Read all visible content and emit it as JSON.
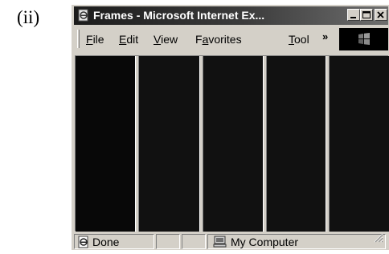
{
  "figure": {
    "caption": "(ii)"
  },
  "window": {
    "title": "Frames - Microsoft Internet Ex...",
    "controls": {
      "minimize": "minimize",
      "maximize": "maximize",
      "close": "close"
    }
  },
  "menubar": {
    "items": [
      {
        "label": "File",
        "accel": "F"
      },
      {
        "label": "Edit",
        "accel": "E"
      },
      {
        "label": "View",
        "accel": "V"
      },
      {
        "label": "Favorites",
        "accel": "a"
      },
      {
        "label": "Tool",
        "accel": "T"
      }
    ],
    "overflow": "»"
  },
  "content": {
    "frame_count": 5,
    "frame_color": "#111111"
  },
  "statusbar": {
    "status": "Done",
    "zone": "My Computer"
  },
  "colors": {
    "chrome": "#d4d0c8",
    "titlebar_start": "#1c1c1c",
    "titlebar_end": "#6e6e6e",
    "content_bg": "#000000"
  },
  "icons": {
    "app": "ie-page-icon",
    "status": "ie-page-icon",
    "zone": "my-computer-icon",
    "throbber": "windows-logo-icon"
  }
}
